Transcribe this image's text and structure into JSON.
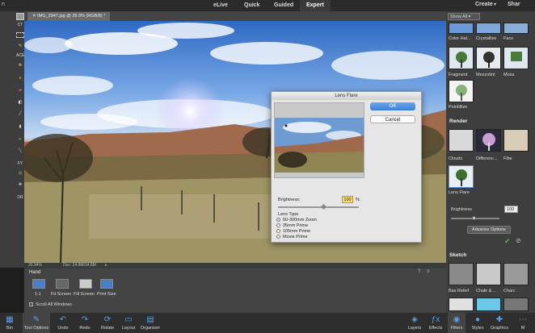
{
  "menu": {
    "left": "n",
    "right_create": "Create",
    "right_share": "Shar"
  },
  "modes": [
    {
      "label": "eLive"
    },
    {
      "label": "Quick"
    },
    {
      "label": "Guided"
    },
    {
      "label": "Expert"
    }
  ],
  "document": {
    "tab": "IMG_2947.jpg @ 26.9% (RGB/8) *",
    "zoom": "26.94%",
    "doc_size": "Doc: 34.8M/34.8M"
  },
  "toolbox": {
    "labels": [
      "CT",
      "ACE",
      "T",
      "FY",
      "DR"
    ]
  },
  "tool_options": {
    "tool": "Hand",
    "buttons": [
      "1:1",
      "Fit Screen",
      "Fill Screen",
      "Print Size"
    ],
    "checkbox": "Scroll All Windows"
  },
  "bottom_bar": {
    "left": [
      {
        "label": "Bin",
        "icon": "photo-bin-icon"
      },
      {
        "label": "Tool Options",
        "icon": "tool-options-icon"
      },
      {
        "label": "Undo",
        "icon": "undo-icon"
      },
      {
        "label": "Redo",
        "icon": "redo-icon"
      },
      {
        "label": "Rotate",
        "icon": "rotate-icon"
      },
      {
        "label": "Layout",
        "icon": "layout-icon"
      },
      {
        "label": "Organizer",
        "icon": "organizer-icon"
      }
    ],
    "right": [
      {
        "label": "Layers",
        "icon": "layers-icon"
      },
      {
        "label": "Effects",
        "icon": "effects-icon"
      },
      {
        "label": "Filters",
        "icon": "filters-icon"
      },
      {
        "label": "Styles",
        "icon": "styles-icon"
      },
      {
        "label": "Graphics",
        "icon": "graphics-icon"
      },
      {
        "label": "M",
        "icon": "more-icon"
      }
    ]
  },
  "filters_panel": {
    "show": "Show All",
    "row1": [
      "Color Hal...",
      "Crystallize",
      "Face"
    ],
    "row2": [
      "Fragment",
      "Mezzotint",
      "Mosa"
    ],
    "row3": [
      "Pointillize"
    ],
    "render_heading": "Render",
    "render": [
      "Clouds",
      "Differenc...",
      "Fibe"
    ],
    "render2": [
      "Lens Flare"
    ],
    "brightness_label": "Brightness",
    "brightness_value": "100",
    "advanced": "Advance Options",
    "sketch_heading": "Sketch",
    "sketch": [
      "Bas Relief",
      "Chalk & ...",
      "Charc"
    ]
  },
  "dialog": {
    "title": "Lens Flare",
    "ok": "OK",
    "cancel": "Cancel",
    "brightness_label": "Brightness:",
    "brightness_value": "100",
    "unit": "%",
    "lens_type": "Lens Type",
    "options": [
      "50-300mm Zoom",
      "35mm Prime",
      "105mm Prime",
      "Movie Prime"
    ],
    "selected": 0,
    "brightness_level": 100
  },
  "colors": {
    "accent": "#3b7fd6",
    "panel": "#3e3e3e",
    "canvas": "#555555"
  }
}
